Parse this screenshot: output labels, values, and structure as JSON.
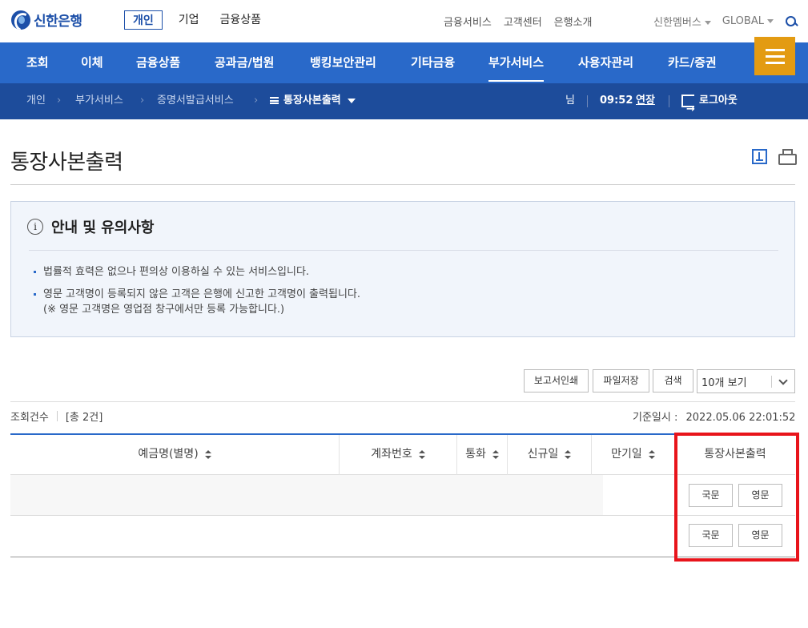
{
  "brand": {
    "name": "신한은행"
  },
  "top_nav": [
    "개인",
    "기업",
    "금융상품"
  ],
  "util_nav": [
    "금융서비스",
    "고객센터",
    "은행소개"
  ],
  "right_nav": {
    "members": "신한멤버스",
    "global": "GLOBAL"
  },
  "main_menu": [
    "조회",
    "이체",
    "금융상품",
    "공과금/법원",
    "뱅킹보안관리",
    "기타금융",
    "부가서비스",
    "사용자관리",
    "카드/증권"
  ],
  "main_menu_active": "부가서비스",
  "breadcrumb": [
    "개인",
    "부가서비스",
    "증명서발급서비스",
    "통장사본출력"
  ],
  "session": {
    "user_suffix": "님",
    "time": "09:52",
    "extend": "연장",
    "logout": "로그아웃"
  },
  "page": {
    "title": "통장사본출력"
  },
  "notice": {
    "title": "안내 및 유의사항",
    "items": [
      "법률적 효력은 없으나 편의상 이용하실 수 있는 서비스입니다.",
      "영문 고객명이 등록되지 않은 고객은 은행에 신고한 고객명이 출력됩니다.",
      "(※ 영문 고객명은 영업점 창구에서만 등록 가능합니다.)"
    ]
  },
  "toolbar": {
    "print_report": "보고서인쇄",
    "save_file": "파일저장",
    "search": "검색",
    "page_size": "10개 보기"
  },
  "list_info": {
    "count_label": "조회건수",
    "count_value": "[총 2건]",
    "base_time_label": "기준일시 :",
    "base_time_value": "2022.05.06 22:01:52"
  },
  "table": {
    "headers": [
      "예금명(별명)",
      "계좌번호",
      "통화",
      "신규일",
      "만기일",
      "통장사본출력"
    ],
    "rows": [
      {
        "korean": "국문",
        "english": "영문"
      },
      {
        "korean": "국문",
        "english": "영문"
      }
    ]
  },
  "colors": {
    "primary": "#2969c9",
    "breadcrumb_bg": "#1d4c9b",
    "menu_button": "#e39b12",
    "highlight": "#e8141b"
  }
}
